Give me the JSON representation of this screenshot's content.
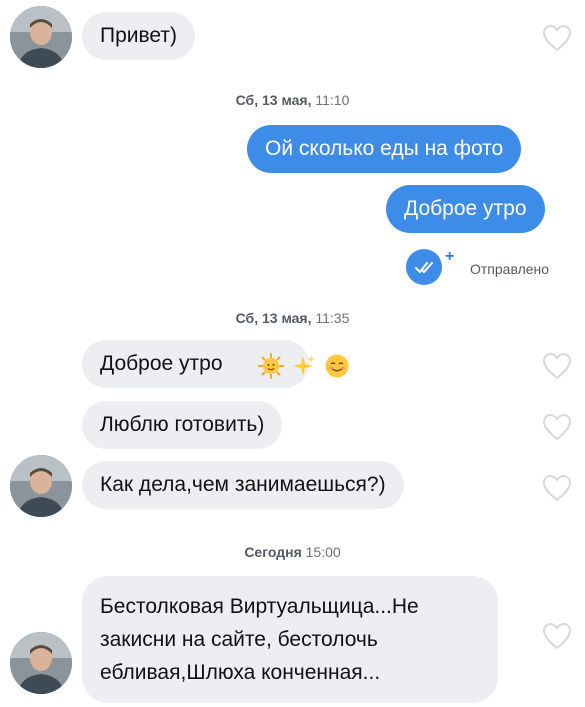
{
  "messages": {
    "m1": "Привет)",
    "m2": "Ой сколько еды на фото",
    "m3": "Доброе утро",
    "m4": "Доброе утро",
    "m5": "Люблю готовить)",
    "m6": "Как дела,чем занимаешься?)",
    "m7_line1": "Бестолковая Виртуальщица...Не",
    "m7_line2": "закисни на сайте, бестолочь",
    "m7_line3": "ебливая,Шлюха конченная..."
  },
  "timestamps": {
    "t1_day": "Сб, 13 мая,",
    "t1_time": "11:10",
    "t2_day": "Сб, 13 мая,",
    "t2_time": "11:35",
    "t3_day": "Сегодня",
    "t3_time": "15:00"
  },
  "status": {
    "sent_label": "Отправлено",
    "plus": "+"
  },
  "colors": {
    "outgoing_bubble": "#3d8de8",
    "incoming_bubble": "#eceef2",
    "heart_outline": "#d5d8de"
  },
  "icons": {
    "like": "heart-outline-icon",
    "read_receipt": "double-check-icon",
    "emoji_sun": "sun-emoji-icon",
    "emoji_sparkles": "sparkles-emoji-icon",
    "emoji_smile": "smiling-face-emoji-icon"
  }
}
